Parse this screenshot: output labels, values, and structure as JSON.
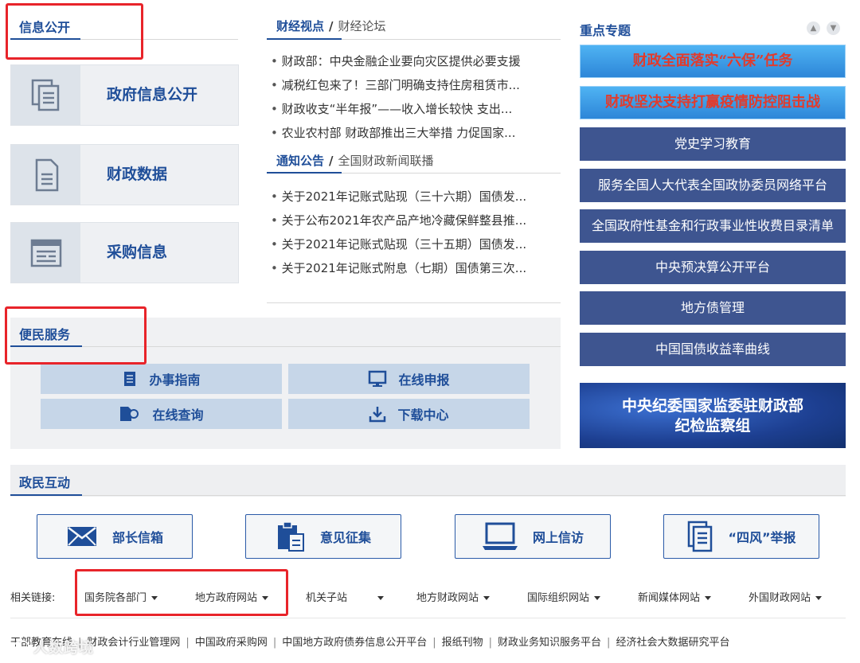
{
  "info_public": {
    "title": "信息公开",
    "cards": [
      {
        "label": "政府信息公开",
        "icon": "documents-icon"
      },
      {
        "label": "财政数据",
        "icon": "document-icon"
      },
      {
        "label": "采购信息",
        "icon": "browser-window-icon"
      }
    ]
  },
  "news_top": {
    "tab_active": "财经视点",
    "tab_inactive": "财经论坛",
    "items": [
      "财政部：中央金融企业要向灾区提供必要支援",
      "减税红包来了！三部门明确支持住房租赁市...",
      "财政收支“半年报”——收入增长较快 支出...",
      "农业农村部 财政部推出三大举措 力促国家..."
    ]
  },
  "news_bottom": {
    "tab_active": "通知公告",
    "tab_inactive": "全国财政新闻联播",
    "items": [
      "关于2021年记账式贴现（三十六期）国债发...",
      "关于公布2021年农产品产地冷藏保鲜整县推...",
      "关于2021年记账式贴现（三十五期）国债发...",
      "关于2021年记账式附息（七期）国债第三次..."
    ]
  },
  "topics": {
    "title": "重点专题",
    "banners": [
      "财政全面落实“六保”任务",
      "财政坚决支持打赢疫情防控阻击战"
    ],
    "buttons": [
      "党史学习教育",
      "服务全国人大代表全国政协委员网络平台",
      "全国政府性基金和行政事业性收费目录清单",
      "中央预决算公开平台",
      "地方债管理",
      "中国国债收益率曲线"
    ],
    "inspection_banner": {
      "line1": "中央纪委国家监委驻财政部",
      "line2": "纪检监察组"
    }
  },
  "services": {
    "title": "便民服务",
    "items": [
      {
        "label": "办事指南",
        "icon": "guide-document-icon"
      },
      {
        "label": "在线申报",
        "icon": "monitor-icon"
      },
      {
        "label": "在线查询",
        "icon": "search-magnifier-icon"
      },
      {
        "label": "下载中心",
        "icon": "download-icon"
      }
    ]
  },
  "interaction": {
    "title": "政民互动",
    "items": [
      {
        "label": "部长信箱",
        "icon": "envelope-icon"
      },
      {
        "label": "意见征集",
        "icon": "clipboard-icon"
      },
      {
        "label": "网上信访",
        "icon": "laptop-icon"
      },
      {
        "label": "“四风”举报",
        "icon": "report-document-icon"
      }
    ]
  },
  "related_links": {
    "label": "相关链接:",
    "items": [
      "国务院各部门",
      "地方政府网站",
      "机关子站",
      "地方财政网站",
      "国际组织网站",
      "新闻媒体网站",
      "外国财政网站"
    ]
  },
  "footer_links": [
    "干部教育在线",
    "财政会计行业管理网",
    "中国政府采购网",
    "中国地方政府债券信息公开平台",
    "报纸刊物",
    "财政业务知识服务平台",
    "经济社会大数据研究平台"
  ],
  "watermark": "人数跨境",
  "colors": {
    "brand_blue": "#1f4e99",
    "button_navy": "#3e5590",
    "highlight_red": "#e8242a"
  }
}
